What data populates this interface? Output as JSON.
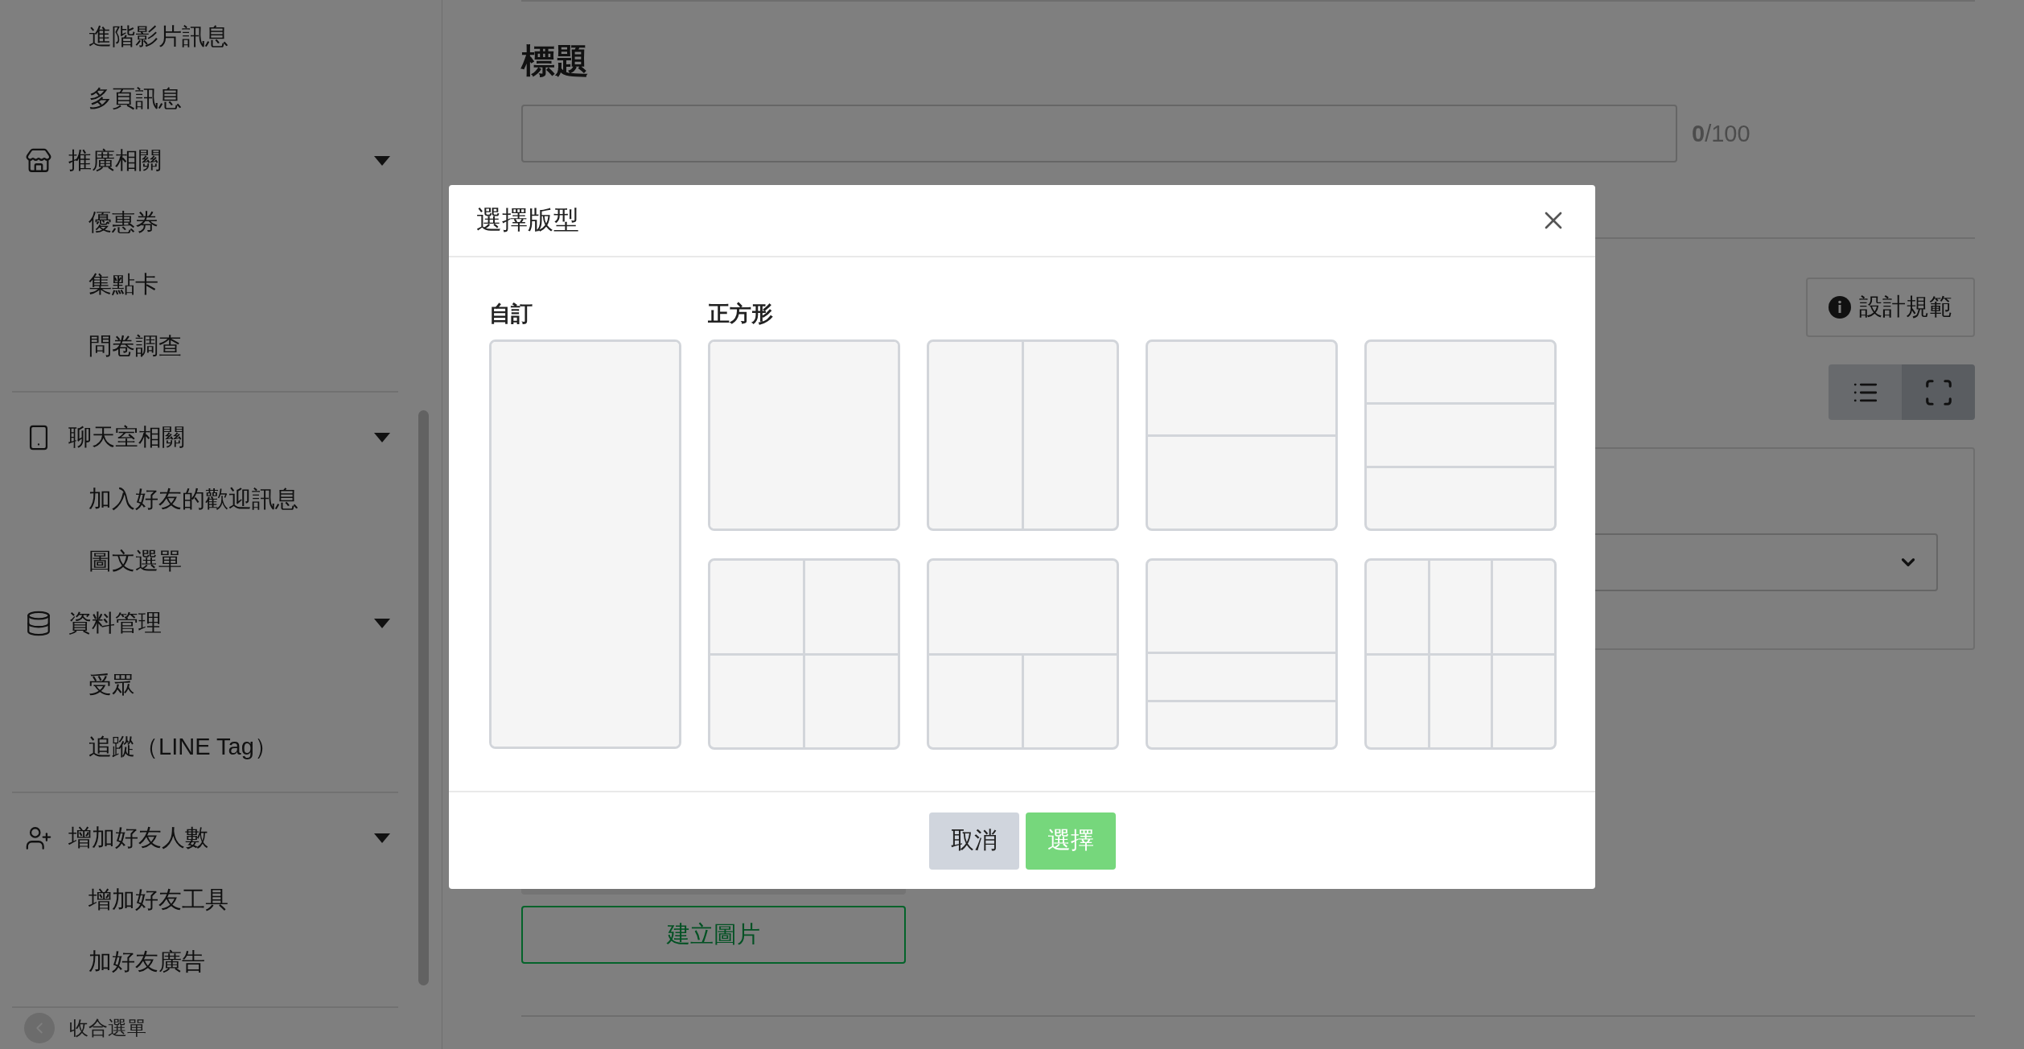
{
  "sidebar": {
    "groups": [
      {
        "entries": [
          {
            "kind": "link",
            "label": "進階影片訊息"
          },
          {
            "kind": "link",
            "label": "多頁訊息"
          },
          {
            "kind": "section",
            "label": "推廣相關",
            "expanded": true,
            "children": [
              {
                "label": "優惠券"
              },
              {
                "label": "集點卡"
              },
              {
                "label": "問卷調查"
              }
            ]
          }
        ]
      },
      {
        "entries": [
          {
            "kind": "section",
            "label": "聊天室相關",
            "expanded": true,
            "children": [
              {
                "label": "加入好友的歡迎訊息"
              },
              {
                "label": "圖文選單"
              }
            ]
          },
          {
            "kind": "section",
            "label": "資料管理",
            "expanded": true,
            "children": [
              {
                "label": "受眾"
              },
              {
                "label": "追蹤（LINE Tag）"
              }
            ]
          }
        ]
      },
      {
        "entries": [
          {
            "kind": "section",
            "label": "增加好友人數",
            "expanded": true,
            "children": [
              {
                "label": "增加好友工具"
              },
              {
                "label": "加好友廣告"
              }
            ]
          }
        ]
      }
    ],
    "collapse": "收合選單"
  },
  "main": {
    "title_field": {
      "label": "標題",
      "counter": "**0**/100"
    },
    "guidelines_button": "設計規範",
    "view_toggle": [
      {
        "kind": "list",
        "selected": false
      },
      {
        "kind": "fullscreen",
        "selected": true
      }
    ],
    "create_image_button": "建立圖片"
  },
  "modal": {
    "title": "選擇版型",
    "groups": [
      {
        "label": "自訂",
        "templates": [
          {
            "kind": "custom"
          }
        ]
      },
      {
        "label": "正方形",
        "templates": [
          {
            "kind": "full"
          },
          {
            "kind": "cols2"
          },
          {
            "kind": "rows2"
          },
          {
            "kind": "rows3"
          },
          {
            "kind": "grid4"
          },
          {
            "kind": "top1-bottom2"
          },
          {
            "kind": "top1-rows2"
          },
          {
            "kind": "grid6"
          }
        ]
      }
    ],
    "buttons": [
      {
        "kind": "secondary",
        "label": "取消"
      },
      {
        "kind": "primary",
        "label": "選擇"
      }
    ]
  }
}
